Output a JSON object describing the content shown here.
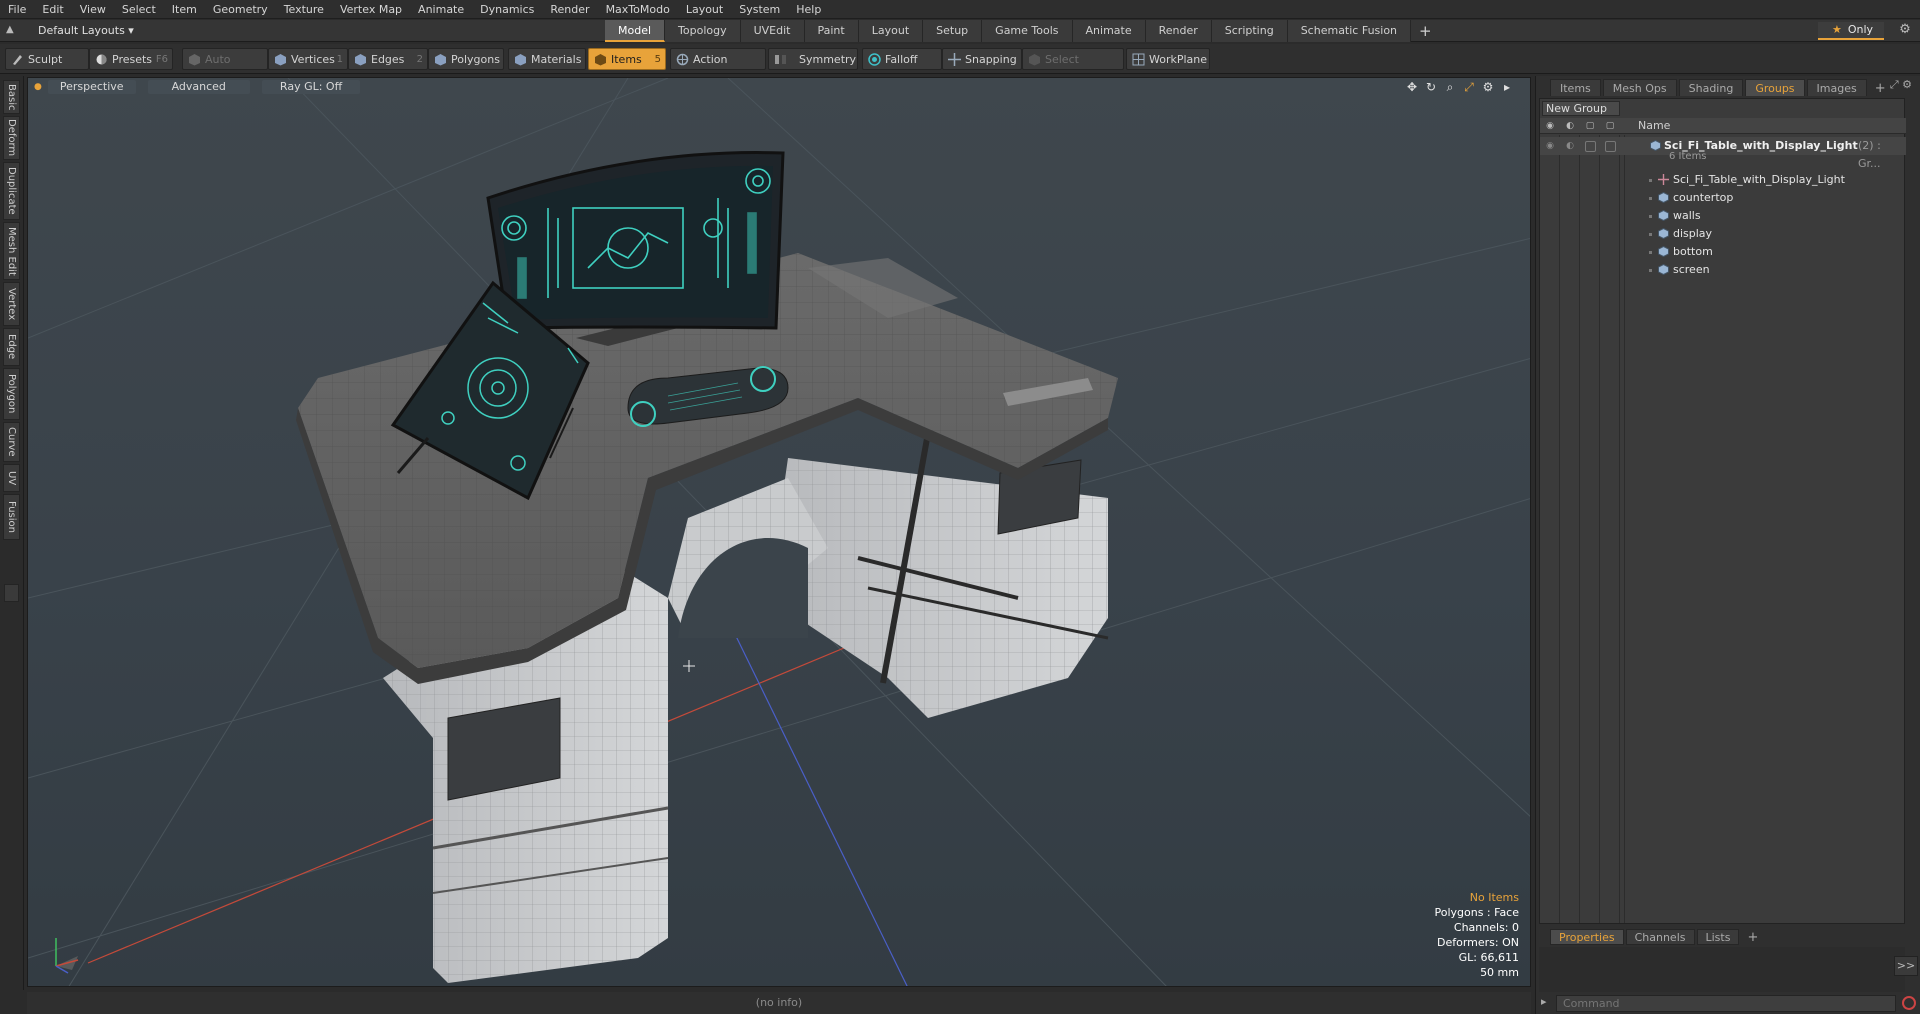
{
  "menu": [
    "File",
    "Edit",
    "View",
    "Select",
    "Item",
    "Geometry",
    "Texture",
    "Vertex Map",
    "Animate",
    "Dynamics",
    "Render",
    "MaxToModo",
    "Layout",
    "System",
    "Help"
  ],
  "layout": {
    "selector": "Default Layouts ▾",
    "tabs": [
      "Model",
      "Topology",
      "UVEdit",
      "Paint",
      "Layout",
      "Setup",
      "Game Tools",
      "Animate",
      "Render",
      "Scripting",
      "Schematic Fusion"
    ],
    "active_tab": "Model",
    "plus": "+",
    "only_label": "Only"
  },
  "toolbar": {
    "sculpt": "Sculpt",
    "presets": "Presets",
    "presets_key": "F6",
    "auto_select": "Auto Select",
    "vertices": "Vertices",
    "vertices_key": "1",
    "edges": "Edges",
    "edges_key": "2",
    "polygons": "Polygons",
    "materials": "Materials",
    "items": "Items",
    "items_key": "5",
    "action_center": "Action Center",
    "symmetry": "Symmetry",
    "falloff": "Falloff",
    "snapping": "Snapping",
    "select_through": "Select Through",
    "workplane": "WorkPlane"
  },
  "left_tabs": [
    "Basic",
    "Deform",
    "Duplicate",
    "Mesh Edit",
    "Vertex",
    "Edge",
    "Polygon",
    "Curve",
    "UV",
    "Fusion"
  ],
  "viewport": {
    "view_mode": "Perspective",
    "shading": "Advanced",
    "raygl": "Ray GL: Off",
    "info": {
      "no_items": "No Items",
      "polygons": "Polygons : Face",
      "channels": "Channels: 0",
      "deformers": "Deformers: ON",
      "gl": "GL: 66,611",
      "unit": "50 mm"
    }
  },
  "statusbar": "(no info)",
  "right_panel": {
    "tabs": [
      "Items",
      "Mesh Ops",
      "Shading",
      "Groups",
      "Images"
    ],
    "active_tab": "Groups",
    "new_group": "New Group",
    "name_col": "Name",
    "root": {
      "name": "Sci_Fi_Table_with_Display_Light",
      "suffix": "(2) : Gr...",
      "count": "6 Items"
    },
    "children": [
      "Sci_Fi_Table_with_Display_Light",
      "countertop",
      "walls",
      "display",
      "bottom",
      "screen"
    ],
    "bottom_tabs": [
      "Properties",
      "Channels",
      "Lists"
    ],
    "bottom_active": "Properties",
    "expand": ">>",
    "command_placeholder": "Command"
  },
  "colors": {
    "accent": "#e8a33a",
    "screen_glow": "#3fd0c0"
  }
}
